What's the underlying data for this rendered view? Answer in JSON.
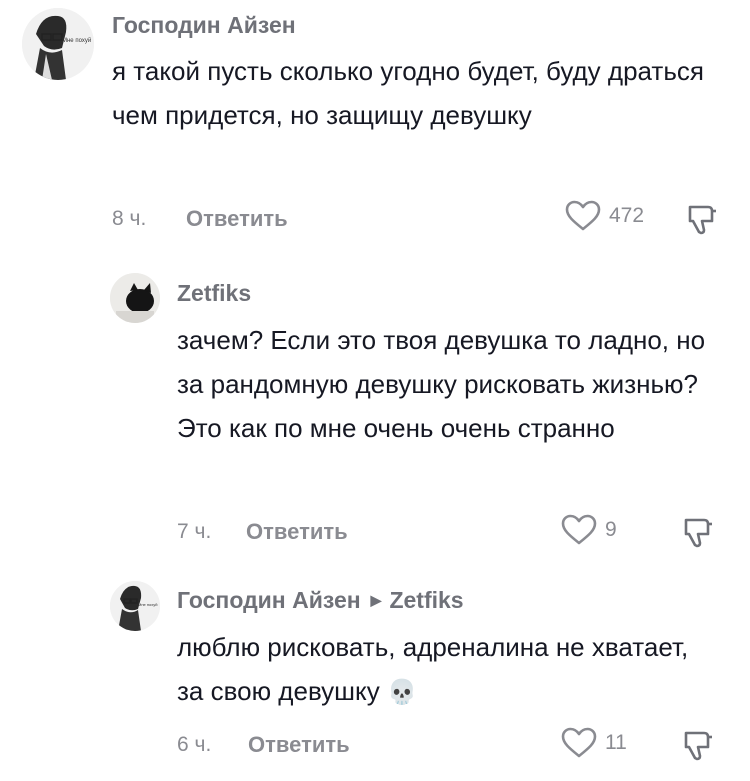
{
  "comments": [
    {
      "author": "Господин Айзен",
      "avatar_label": "Мне похуй",
      "text": "я такой пусть сколько угодно будет, буду драться чем придется, но защищу девушку",
      "time": "8 ч.",
      "reply_label": "Ответить",
      "likes": "472"
    },
    {
      "author": "Zetfiks",
      "text": "зачем? Если это твоя девушка то ладно, но за рандомную девушку рисковать жизнью? Это как по мне очень очень странно",
      "time": "7 ч.",
      "reply_label": "Ответить",
      "likes": "9"
    },
    {
      "author": "Господин Айзен",
      "avatar_label": "Мне похуй",
      "reply_to": "Zetfiks",
      "text": "люблю рисковать, адреналина не хватает, за свою девушку",
      "emoji": "💀",
      "time": "6 ч.",
      "reply_label": "Ответить",
      "likes": "11"
    }
  ],
  "icons": {
    "like": "heart-outline-icon",
    "dislike": "thumbs-down-icon",
    "reply_arrow": "triangle-right-icon",
    "skull": "skull-emoji"
  },
  "colors": {
    "text": "#161823",
    "secondary": "#8a8b91",
    "name": "#6f7178"
  }
}
